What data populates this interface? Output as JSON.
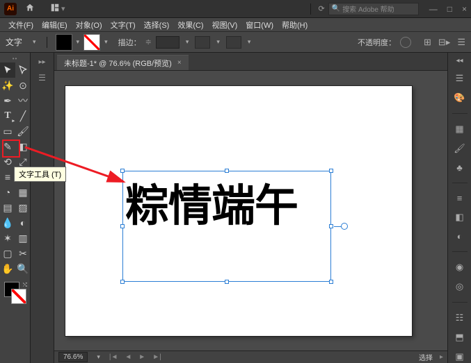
{
  "titlebar": {
    "logo": "Ai",
    "search_placeholder": "搜索 Adobe 帮助",
    "win_min": "—",
    "win_max": "□",
    "win_close": "×"
  },
  "menu": {
    "file": "文件(F)",
    "edit": "编辑(E)",
    "object": "对象(O)",
    "type": "文字(T)",
    "select": "选择(S)",
    "effect": "效果(C)",
    "view": "视图(V)",
    "window": "窗口(W)",
    "help": "帮助(H)"
  },
  "control": {
    "mode": "文字",
    "stroke_label": "描边：",
    "stroke_value": "",
    "opacity_label": "不透明度："
  },
  "document": {
    "tab_title": "未标题-1* @ 76.6% (RGB/预览)"
  },
  "canvas": {
    "text": "粽情端午"
  },
  "tooltip": {
    "text": "文字工具 (T)"
  },
  "status": {
    "zoom": "76.6%",
    "mode": "选择",
    "nav_left": "◄",
    "nav_right": "►"
  },
  "tools": {
    "selection": "sel",
    "direct": "dir",
    "wand": "wand",
    "lasso": "lasso",
    "pen": "pen",
    "curv": "curv",
    "type": "T",
    "line": "line",
    "rect": "rect",
    "brush": "brush",
    "pencil": "pencil",
    "blob": "blob",
    "eraser": "erase",
    "rot": "rot",
    "scale": "scale",
    "width": "width",
    "free": "free",
    "shape": "shape",
    "persp": "persp",
    "mesh": "mesh",
    "grad": "grad",
    "eyedrop": "eye",
    "blend": "blend",
    "sym": "sym",
    "graph": "graph",
    "art": "art",
    "slice": "slice",
    "hand": "hand",
    "zoom": "zoom"
  },
  "right_panels": {
    "p1": "props",
    "p2": "color",
    "p3": "swatches",
    "p4": "brushes",
    "p5": "symbols",
    "p6": "stroke",
    "p7": "grad",
    "p8": "trans",
    "p9": "app",
    "p10": "graphic",
    "p11": "layers",
    "p12": "assets",
    "p13": "art"
  }
}
